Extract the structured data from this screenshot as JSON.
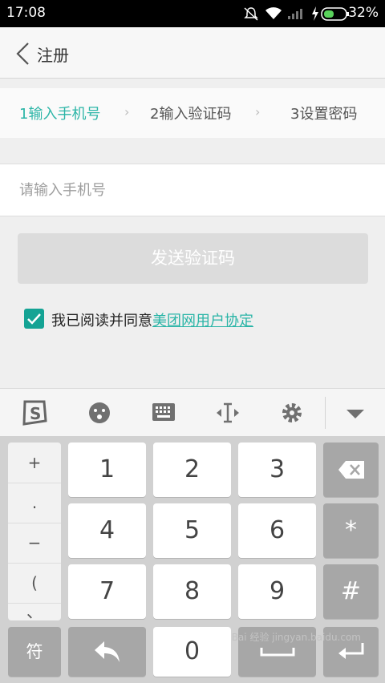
{
  "status_bar": {
    "time": "17:08",
    "battery": "32%"
  },
  "header": {
    "title": "注册"
  },
  "steps": [
    {
      "label": "1输入手机号",
      "active": true
    },
    {
      "label": "2输入验证码",
      "active": false
    },
    {
      "label": "3设置密码",
      "active": false
    }
  ],
  "phone_input": {
    "placeholder": "请输入手机号",
    "value": ""
  },
  "send_button": {
    "label": "发送验证码"
  },
  "agreement": {
    "text": "我已阅读并同意",
    "link": "美团网用户协定",
    "checked": true
  },
  "keyboard": {
    "symbols": [
      "+",
      ".",
      "−",
      "(",
      "、"
    ],
    "digits": [
      "1",
      "2",
      "3",
      "4",
      "5",
      "6",
      "7",
      "8",
      "9",
      "0"
    ],
    "right_keys": [
      "*",
      "#"
    ],
    "symbol_key": "符"
  },
  "watermark": "Bai 经验 jingyan.baidu.com",
  "colors": {
    "accent": "#2bb5a7",
    "checkbox": "#14a394"
  }
}
